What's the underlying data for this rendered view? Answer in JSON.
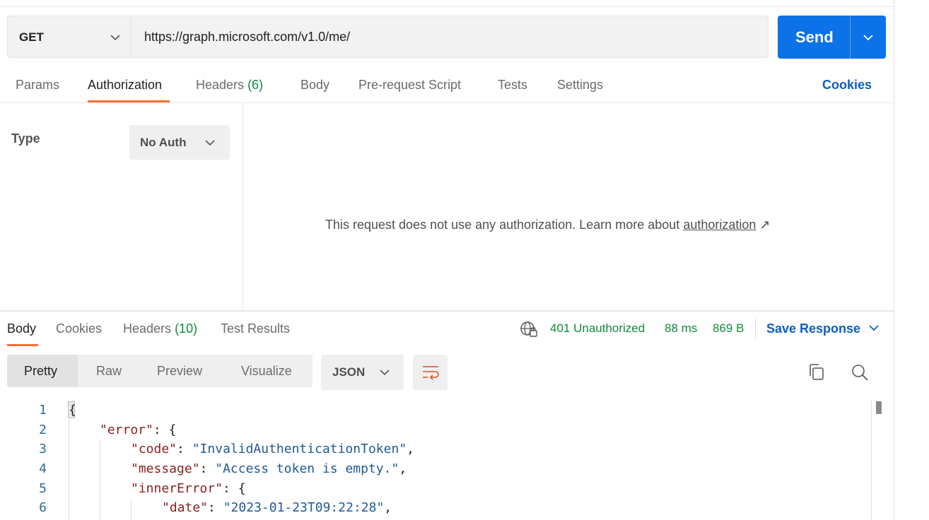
{
  "request": {
    "method": "GET",
    "url": "https://graph.microsoft.com/v1.0/me/",
    "send_label": "Send"
  },
  "request_tabs": [
    {
      "label": "Params"
    },
    {
      "label": "Authorization",
      "active": true
    },
    {
      "label": "Headers",
      "count": "(6)"
    },
    {
      "label": "Body"
    },
    {
      "label": "Pre-request Script"
    },
    {
      "label": "Tests"
    },
    {
      "label": "Settings"
    }
  ],
  "cookies_label": "Cookies",
  "auth": {
    "type_label": "Type",
    "selected": "No Auth",
    "message": "This request does not use any authorization. Learn more about ",
    "link_text": "authorization",
    "arrow": "↗"
  },
  "response_tabs": [
    {
      "label": "Body",
      "active": true
    },
    {
      "label": "Cookies"
    },
    {
      "label": "Headers",
      "count": "(10)"
    },
    {
      "label": "Test Results"
    }
  ],
  "response_status": {
    "status": "401 Unauthorized",
    "time": "88 ms",
    "size": "869 B",
    "save_label": "Save Response"
  },
  "view_modes": [
    {
      "label": "Pretty",
      "active": true
    },
    {
      "label": "Raw"
    },
    {
      "label": "Preview"
    },
    {
      "label": "Visualize"
    }
  ],
  "format": "JSON",
  "code_lines": [
    {
      "n": "1"
    },
    {
      "n": "2",
      "key": "\"error\"",
      "rest": ": {"
    },
    {
      "n": "3",
      "key": "\"code\"",
      "val": "\"InvalidAuthenticationToken\"",
      "tail": ","
    },
    {
      "n": "4",
      "key": "\"message\"",
      "val": "\"Access token is empty.\"",
      "tail": ","
    },
    {
      "n": "5",
      "key": "\"innerError\"",
      "rest": ": {"
    },
    {
      "n": "6",
      "key": "\"date\"",
      "val": "\"2023-01-23T09:22:28\"",
      "tail": ","
    }
  ],
  "first_brace": "{",
  "icons": {
    "method_dropdown": "chevron-down-icon",
    "send_dropdown": "chevron-down-icon",
    "network": "globe-icon",
    "wrap": "wrap-lines-icon",
    "copy": "copy-icon",
    "search": "search-icon"
  },
  "colors": {
    "accent": "#ff6c37",
    "send": "#0b72e7",
    "link": "#0b5ec2",
    "status_ok_green": "#0f8a3c"
  }
}
